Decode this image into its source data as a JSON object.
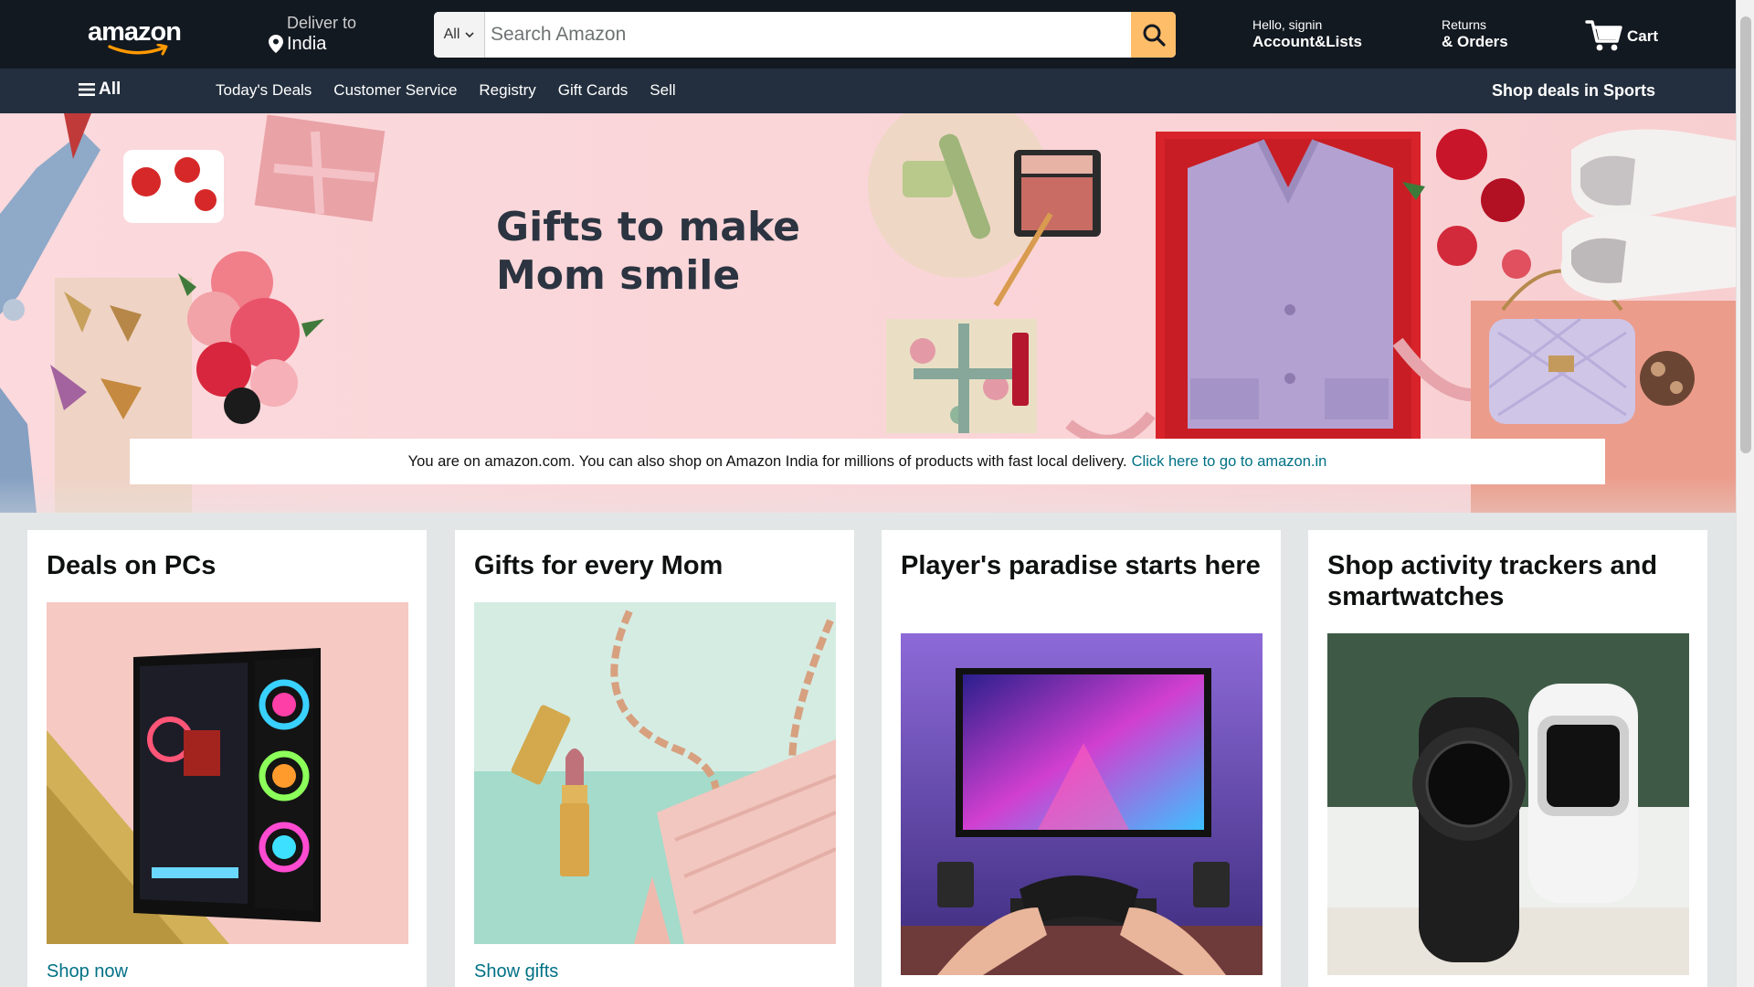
{
  "header": {
    "logo_text": "amazon",
    "deliver_label": "Deliver to",
    "deliver_location": "India",
    "search_category": "All",
    "search_placeholder": "Search Amazon",
    "account_greeting": "Hello, signin",
    "account_label": "Account&Lists",
    "returns_top": "Returns",
    "returns_bottom": "& Orders",
    "cart_label": "Cart"
  },
  "subnav": {
    "all_label": "All",
    "links": [
      "Today's Deals",
      "Customer Service",
      "Registry",
      "Gift Cards",
      "Sell"
    ],
    "promo": "Shop deals in Sports"
  },
  "hero": {
    "title_line1": "Gifts to make",
    "title_line2": "Mom smile",
    "notice_text": "You are on amazon.com. You can also shop on Amazon India for millions of products with fast local delivery.",
    "notice_link": "Click here to go to amazon.in"
  },
  "cards": [
    {
      "title": "Deals on PCs",
      "link": "Shop now",
      "icon": "gaming-pc-image"
    },
    {
      "title": "Gifts for every Mom",
      "link": "Show gifts",
      "icon": "lipstick-purse-image"
    },
    {
      "title": "Player's paradise starts here",
      "link": "",
      "icon": "gaming-monitor-image"
    },
    {
      "title": "Shop activity trackers and smartwatches",
      "link": "",
      "icon": "smartwatches-image"
    }
  ],
  "colors": {
    "nav_bg": "#131921",
    "subnav_bg": "#232f3e",
    "search_button": "#febd69",
    "link": "#007185",
    "page_bg": "#e3e6e6"
  }
}
